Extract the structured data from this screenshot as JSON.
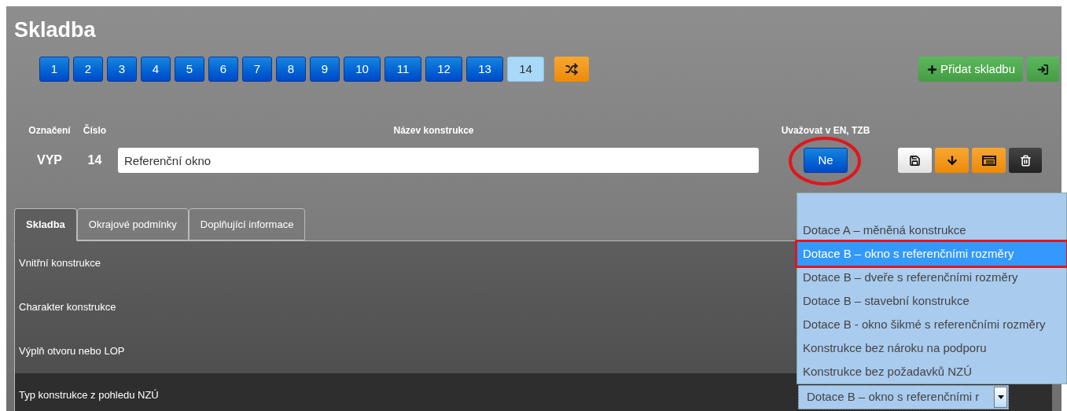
{
  "title": "Skladba",
  "pages": [
    {
      "label": "1",
      "selected": false
    },
    {
      "label": "2",
      "selected": false
    },
    {
      "label": "3",
      "selected": false
    },
    {
      "label": "4",
      "selected": false
    },
    {
      "label": "5",
      "selected": false
    },
    {
      "label": "6",
      "selected": false
    },
    {
      "label": "7",
      "selected": false
    },
    {
      "label": "8",
      "selected": false
    },
    {
      "label": "9",
      "selected": false
    },
    {
      "label": "10",
      "selected": false
    },
    {
      "label": "11",
      "selected": false
    },
    {
      "label": "12",
      "selected": false
    },
    {
      "label": "13",
      "selected": false
    },
    {
      "label": "14",
      "selected": true
    }
  ],
  "add_button": "Přidat skladbu",
  "columns": [
    "Označení",
    "Číslo",
    "Název konstrukce",
    "Uvažovat v EN, TZB"
  ],
  "record": {
    "code": "VYP",
    "number": "14",
    "name": "Referenční okno",
    "consider": "Ne"
  },
  "tabs": [
    {
      "label": "Skladba",
      "selected": true
    },
    {
      "label": "Okrajové podmínky",
      "selected": false
    },
    {
      "label": "Doplňující informace",
      "selected": false
    }
  ],
  "fields": [
    {
      "label": "Vnitřní konstrukce",
      "selected": false
    },
    {
      "label": "Charakter konstrukce",
      "selected": false
    },
    {
      "label": "Výplň otvoru nebo LOP",
      "selected": false
    },
    {
      "label": "Typ konstrukce z pohledu NZÚ",
      "selected": true
    }
  ],
  "select": {
    "value": "Dotace B – okno s referenčními r",
    "expanded": true,
    "options": [
      {
        "label": "Dotace A – měněná konstrukce",
        "selected": false
      },
      {
        "label": "Dotace B – okno s referenčními rozměry",
        "selected": true
      },
      {
        "label": "Dotace B – dveře s referenčními rozměry",
        "selected": false
      },
      {
        "label": "Dotace B – stavební konstrukce",
        "selected": false
      },
      {
        "label": "Dotace B - okno šikmé s referenčními rozměry",
        "selected": false
      },
      {
        "label": "Konstrukce bez nároku na podporu",
        "selected": false
      },
      {
        "label": "Konstrukce bez požadavků NZÚ",
        "selected": false
      }
    ]
  }
}
